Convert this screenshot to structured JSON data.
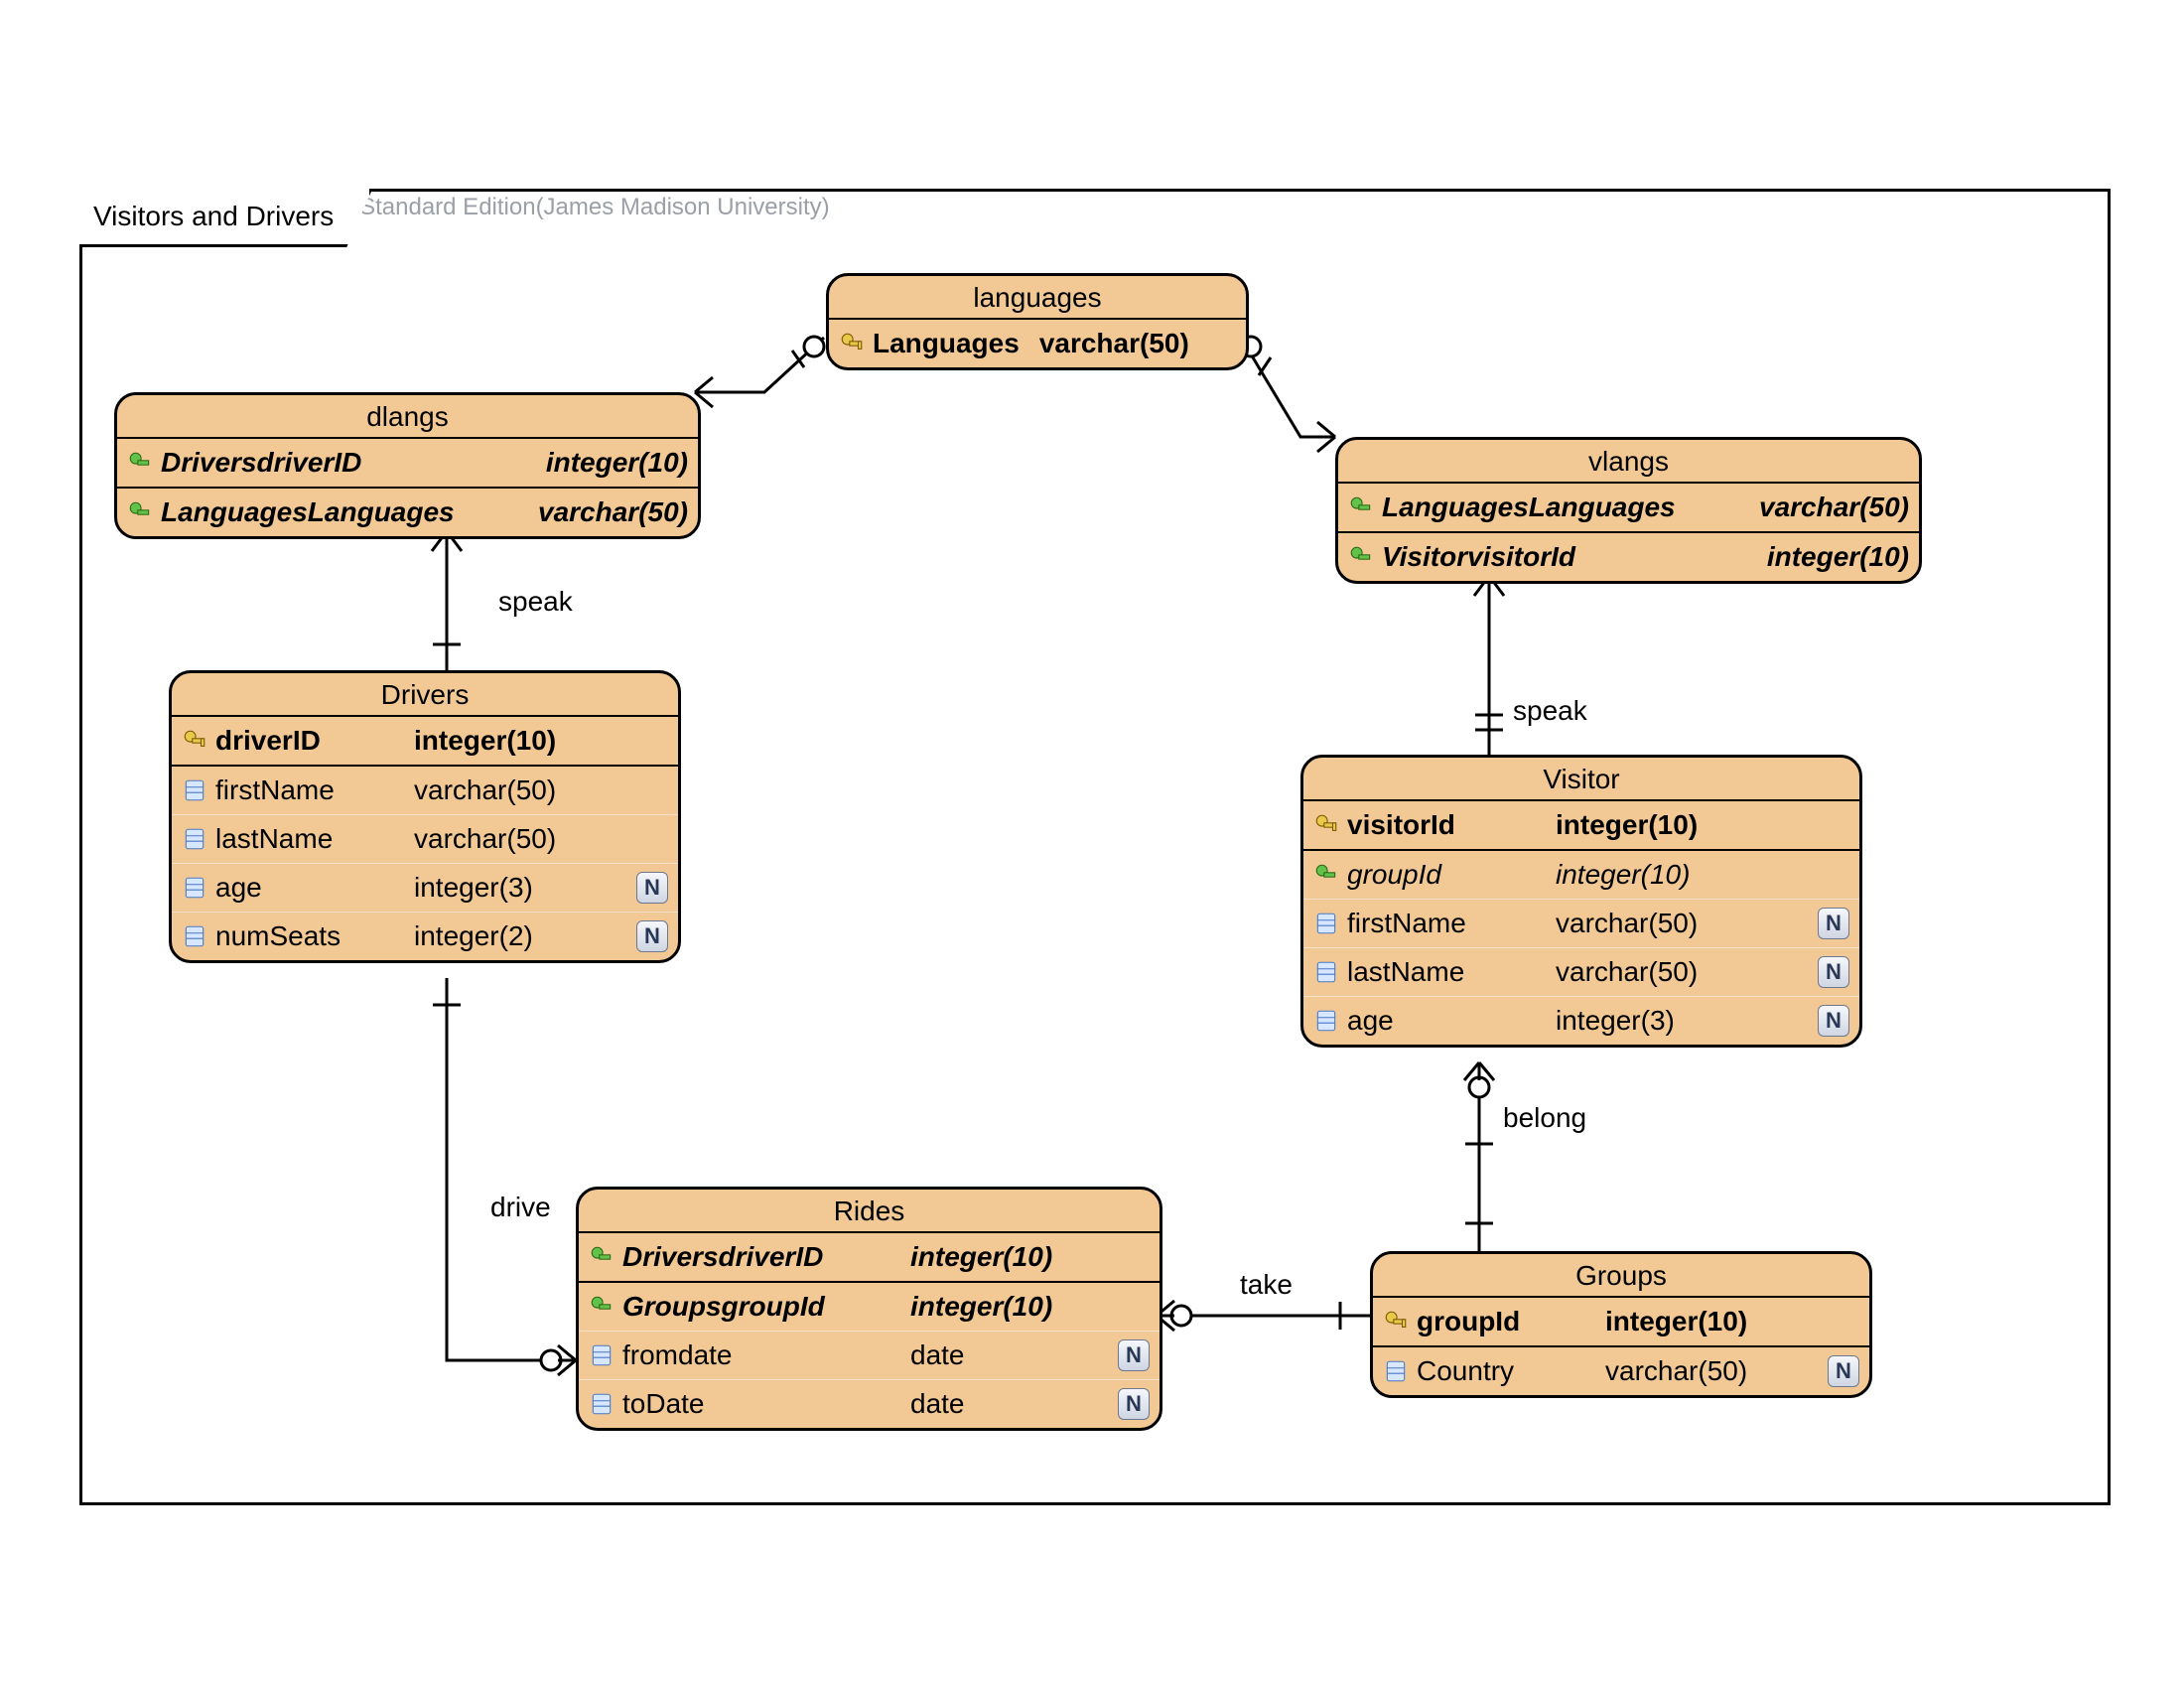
{
  "watermark": "Visual Paradigm for UML Standard Edition(James Madison University)",
  "frame": {
    "title": "Visitors and Drivers"
  },
  "entities": {
    "languages": {
      "title": "languages",
      "cols": [
        {
          "name": "Languages",
          "type": "varchar(50)",
          "icon": "pk",
          "bold": true,
          "italic": false,
          "nullable": false
        }
      ]
    },
    "dlangs": {
      "title": "dlangs",
      "cols": [
        {
          "name": "DriversdriverID",
          "type": "integer(10)",
          "icon": "fk",
          "bold": true,
          "italic": true,
          "nullable": false
        },
        {
          "name": "LanguagesLanguages",
          "type": "varchar(50)",
          "icon": "fk",
          "bold": true,
          "italic": true,
          "nullable": false
        }
      ]
    },
    "vlangs": {
      "title": "vlangs",
      "cols": [
        {
          "name": "LanguagesLanguages",
          "type": "varchar(50)",
          "icon": "fk",
          "bold": true,
          "italic": true,
          "nullable": false
        },
        {
          "name": "VisitorvisitorId",
          "type": "integer(10)",
          "icon": "fk",
          "bold": true,
          "italic": true,
          "nullable": false
        }
      ]
    },
    "drivers": {
      "title": "Drivers",
      "cols": [
        {
          "name": "driverID",
          "type": "integer(10)",
          "icon": "pk",
          "bold": true,
          "italic": false,
          "nullable": false
        },
        {
          "name": "firstName",
          "type": "varchar(50)",
          "icon": "col",
          "bold": false,
          "italic": false,
          "nullable": false
        },
        {
          "name": "lastName",
          "type": "varchar(50)",
          "icon": "col",
          "bold": false,
          "italic": false,
          "nullable": false
        },
        {
          "name": "age",
          "type": "integer(3)",
          "icon": "col",
          "bold": false,
          "italic": false,
          "nullable": true
        },
        {
          "name": "numSeats",
          "type": "integer(2)",
          "icon": "col",
          "bold": false,
          "italic": false,
          "nullable": true
        }
      ]
    },
    "visitor": {
      "title": "Visitor",
      "cols": [
        {
          "name": "visitorId",
          "type": "integer(10)",
          "icon": "pk",
          "bold": true,
          "italic": false,
          "nullable": false
        },
        {
          "name": "groupId",
          "type": "integer(10)",
          "icon": "fk",
          "bold": false,
          "italic": true,
          "nullable": false
        },
        {
          "name": "firstName",
          "type": "varchar(50)",
          "icon": "col",
          "bold": false,
          "italic": false,
          "nullable": true
        },
        {
          "name": "lastName",
          "type": "varchar(50)",
          "icon": "col",
          "bold": false,
          "italic": false,
          "nullable": true
        },
        {
          "name": "age",
          "type": "integer(3)",
          "icon": "col",
          "bold": false,
          "italic": false,
          "nullable": true
        }
      ]
    },
    "rides": {
      "title": "Rides",
      "cols": [
        {
          "name": "DriversdriverID",
          "type": "integer(10)",
          "icon": "fk",
          "bold": true,
          "italic": true,
          "nullable": false
        },
        {
          "name": "GroupsgroupId",
          "type": "integer(10)",
          "icon": "fk",
          "bold": true,
          "italic": true,
          "nullable": false
        },
        {
          "name": "fromdate",
          "type": "date",
          "icon": "col",
          "bold": false,
          "italic": false,
          "nullable": true
        },
        {
          "name": "toDate",
          "type": "date",
          "icon": "col",
          "bold": false,
          "italic": false,
          "nullable": true
        }
      ]
    },
    "groups": {
      "title": "Groups",
      "cols": [
        {
          "name": "groupId",
          "type": "integer(10)",
          "icon": "pk",
          "bold": true,
          "italic": false,
          "nullable": false
        },
        {
          "name": "Country",
          "type": "varchar(50)",
          "icon": "col",
          "bold": false,
          "italic": false,
          "nullable": true
        }
      ]
    }
  },
  "relationships": {
    "speak1": "speak",
    "speak2": "speak",
    "drive": "drive",
    "take": "take",
    "belong": "belong"
  },
  "nullable_badge": "N"
}
